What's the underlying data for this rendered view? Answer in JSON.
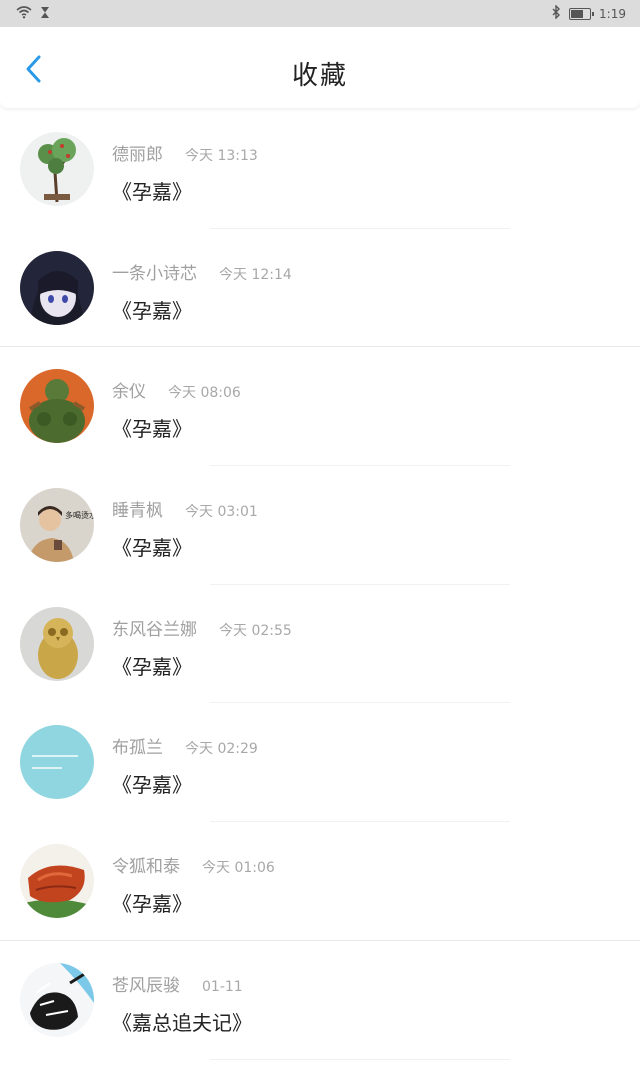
{
  "status_bar": {
    "time": "1:19",
    "icons": [
      "wifi-icon",
      "hourglass-icon",
      "bluetooth-icon",
      "battery-icon"
    ],
    "battery_level": 0.7
  },
  "header": {
    "title": "收藏",
    "back_icon": "chevron-left-icon"
  },
  "colors": {
    "accent": "#2a9ae8",
    "status_bg": "#dcdcdc",
    "name_text": "#a0a0a0",
    "book_text": "#222222"
  },
  "favorites": [
    {
      "name": "德丽郎",
      "time": "今天 13:13",
      "book": "《孕嘉》",
      "avatar": "bonsai-tree-avatar"
    },
    {
      "name": "一条小诗芯",
      "time": "今天 12:14",
      "book": "《孕嘉》",
      "avatar": "anime-girl-avatar"
    },
    {
      "name": "余仪",
      "time": "今天 08:06",
      "book": "《孕嘉》",
      "avatar": "green-monster-avatar"
    },
    {
      "name": "睡青枫",
      "time": "今天 03:01",
      "book": "《孕嘉》",
      "avatar": "young-man-avatar"
    },
    {
      "name": "东风谷兰娜",
      "time": "今天 02:55",
      "book": "《孕嘉》",
      "avatar": "owl-statue-avatar"
    },
    {
      "name": "布孤兰",
      "time": "今天 02:29",
      "book": "《孕嘉》",
      "avatar": "blue-text-avatar"
    },
    {
      "name": "令狐和泰",
      "time": "今天 01:06",
      "book": "《孕嘉》",
      "avatar": "food-dish-avatar"
    },
    {
      "name": "苍风辰骏",
      "time": "01-11",
      "book": "《嘉总追夫记》",
      "avatar": "ink-sketch-avatar"
    }
  ]
}
